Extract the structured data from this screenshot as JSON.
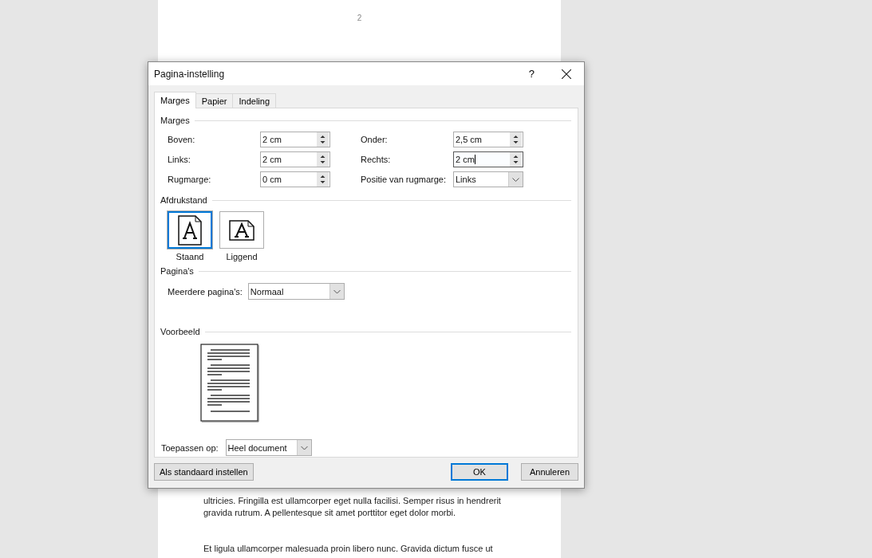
{
  "document": {
    "page_number": "2",
    "paragraphs": [
      [
        "ultricies. Fringilla est ullamcorper eget nulla facilisi. Semper risus in hendrerit",
        "gravida rutrum. A pellentesque sit amet porttitor eget dolor morbi."
      ],
      [
        "Et ligula ullamcorper malesuada proin libero nunc. Gravida dictum fusce ut"
      ]
    ]
  },
  "dialog": {
    "title": "Pagina-instelling",
    "help": "?",
    "tabs": [
      {
        "label": "Marges",
        "selected": true
      },
      {
        "label": "Papier",
        "selected": false
      },
      {
        "label": "Indeling",
        "selected": false
      }
    ],
    "margins": {
      "heading": "Marges",
      "fields": [
        {
          "label": "Boven:",
          "value": "2 cm",
          "kind": "spin",
          "focused": false
        },
        {
          "label": "Onder:",
          "value": "2,5 cm",
          "kind": "spin",
          "focused": false
        },
        {
          "label": "Links:",
          "value": "2 cm",
          "kind": "spin",
          "focused": false
        },
        {
          "label": "Rechts:",
          "value": "2 cm",
          "kind": "spin",
          "focused": true
        },
        {
          "label": "Rugmarge:",
          "value": "0 cm",
          "kind": "spin",
          "focused": false
        },
        {
          "label": "Positie van rugmarge:",
          "value": "Links",
          "kind": "dropdown",
          "focused": false
        }
      ]
    },
    "orientation": {
      "heading": "Afdrukstand",
      "options": [
        {
          "label": "Staand",
          "kind": "portrait",
          "selected": true
        },
        {
          "label": "Liggend",
          "kind": "landscape",
          "selected": false
        }
      ]
    },
    "pages": {
      "heading": "Pagina's",
      "label": "Meerdere pagina's:",
      "value": "Normaal"
    },
    "preview": {
      "heading": "Voorbeeld"
    },
    "apply": {
      "label": "Toepassen op:",
      "value": "Heel document"
    },
    "buttons": [
      {
        "label": "Als standaard instellen",
        "kind": "left"
      },
      {
        "label": "OK",
        "kind": "default"
      },
      {
        "label": "Annuleren",
        "kind": "normal"
      }
    ]
  }
}
